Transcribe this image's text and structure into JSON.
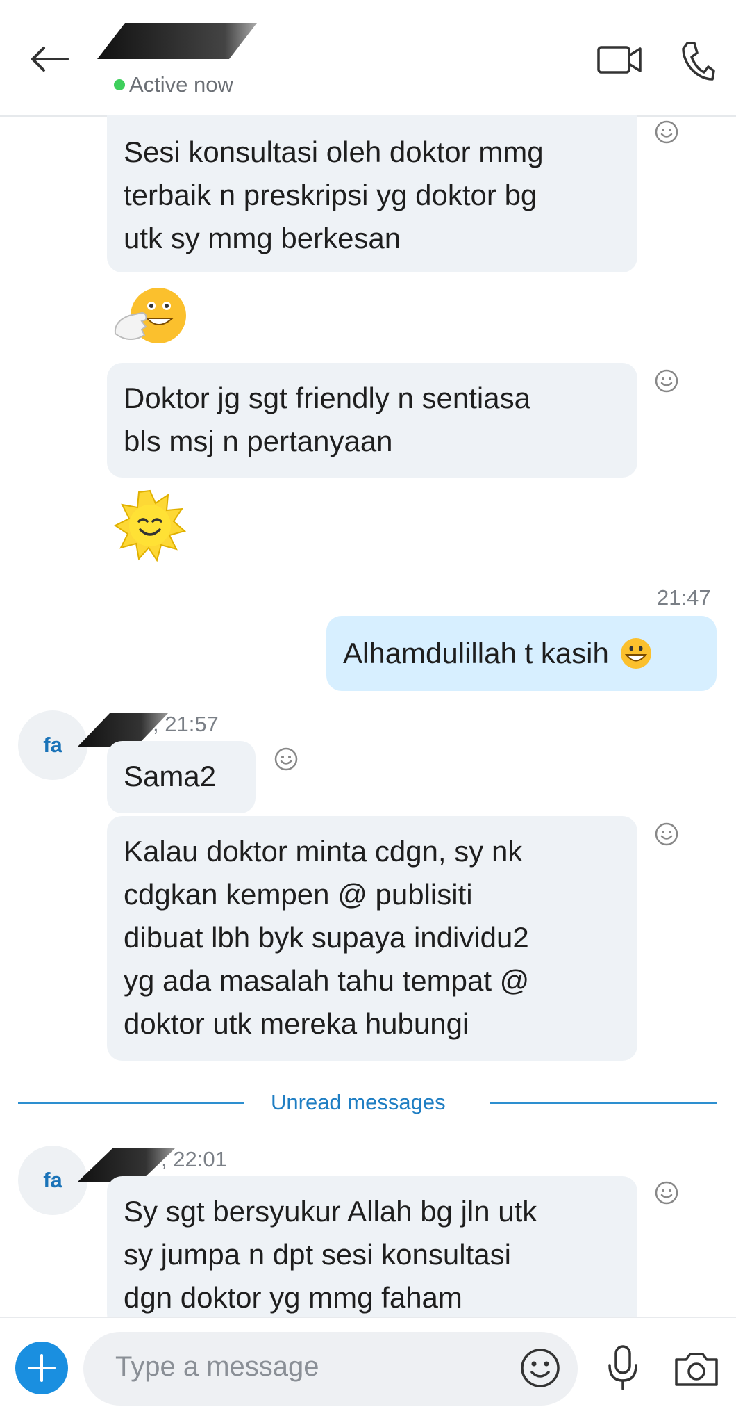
{
  "header": {
    "status": "Active now"
  },
  "messages": {
    "m1": [
      "Sesi konsultasi oleh doktor mmg",
      "terbaik n preskripsi yg doktor bg",
      "utk sy mmg berkesan"
    ],
    "m2": [
      "Doktor jg sgt friendly n sentiasa",
      "bls msj n pertanyaan"
    ],
    "sent_time": "21:47",
    "sent_text": "Alhamdulillah t kasih",
    "sender_a_time": ", 21:57",
    "sender_initials_a": "fa",
    "m3": "Sama2",
    "m4": [
      "Kalau doktor minta cdgn, sy nk",
      "cdgkan kempen @ publisiti",
      "dibuat lbh byk supaya individu2",
      "yg ada masalah tahu tempat @",
      "doktor utk mereka hubungi"
    ],
    "unread_label": "Unread messages",
    "sender_b_time": ", 22:01",
    "sender_initials_b": "fa",
    "m5": [
      "Sy sgt bersyukur Allah bg jln utk",
      "sy jumpa n dpt sesi konsultasi",
      "dgn doktor yg mmg faham"
    ]
  },
  "composer": {
    "placeholder": "Type a message"
  },
  "icons": {
    "back": "arrow-left-icon",
    "video": "video-camera-icon",
    "call": "phone-icon",
    "reaction": "smiley-outline-icon",
    "plus": "plus-icon",
    "emoji": "smiley-icon",
    "mic": "microphone-icon",
    "camera": "camera-icon"
  },
  "colors": {
    "accent": "#1a8fe0",
    "sent_bubble": "#d7efff",
    "received_bubble": "#eef2f6",
    "online": "#3ecf5c",
    "unread": "#2d8fd0"
  }
}
